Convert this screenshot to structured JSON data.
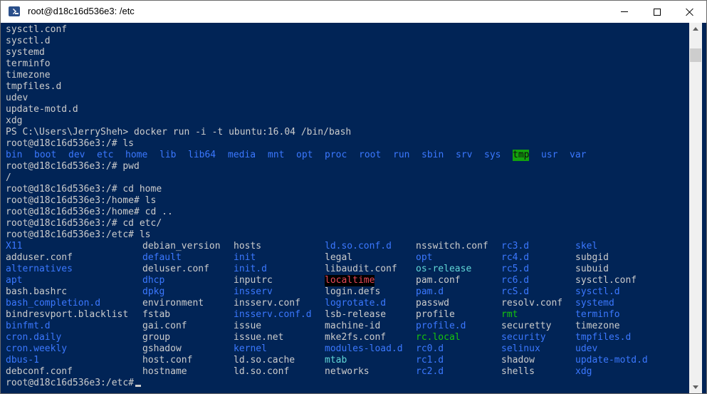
{
  "window": {
    "title": "root@d18c16d536e3: /etc"
  },
  "colors": {
    "background": "#012456",
    "text": "#cccccc",
    "directory": "#3b78ff",
    "symlink": "#61d6d6",
    "executable": "#16c60c",
    "broken_link": "#e74856",
    "sticky_dir_bg": "#13a10e"
  },
  "console": {
    "lines": [
      [
        {
          "t": "sysctl.conf"
        }
      ],
      [
        {
          "t": "sysctl.d"
        }
      ],
      [
        {
          "t": "systemd"
        }
      ],
      [
        {
          "t": "terminfo"
        }
      ],
      [
        {
          "t": "timezone"
        }
      ],
      [
        {
          "t": "tmpfiles.d"
        }
      ],
      [
        {
          "t": "udev"
        }
      ],
      [
        {
          "t": "update-motd.d"
        }
      ],
      [
        {
          "t": "xdg"
        }
      ],
      [
        {
          "t": "PS C:\\Users\\JerrySheh> docker run -i -t ubuntu:16.04 /bin/bash"
        }
      ],
      [
        {
          "t": "root@d18c16d536e3:/# ls"
        }
      ],
      [
        {
          "t": "bin",
          "c": 0,
          "k": "dir"
        },
        {
          "t": "boot",
          "c": 5,
          "k": "dir"
        },
        {
          "t": "dev",
          "c": 11,
          "k": "dir"
        },
        {
          "t": "etc",
          "c": 16,
          "k": "dir"
        },
        {
          "t": "home",
          "c": 21,
          "k": "dir"
        },
        {
          "t": "lib",
          "c": 27,
          "k": "dir"
        },
        {
          "t": "lib64",
          "c": 32,
          "k": "dir"
        },
        {
          "t": "media",
          "c": 39,
          "k": "dir"
        },
        {
          "t": "mnt",
          "c": 46,
          "k": "dir"
        },
        {
          "t": "opt",
          "c": 51,
          "k": "dir"
        },
        {
          "t": "proc",
          "c": 56,
          "k": "dir"
        },
        {
          "t": "root",
          "c": 62,
          "k": "dir"
        },
        {
          "t": "run",
          "c": 68,
          "k": "dir"
        },
        {
          "t": "sbin",
          "c": 73,
          "k": "dir"
        },
        {
          "t": "srv",
          "c": 79,
          "k": "dir"
        },
        {
          "t": "sys",
          "c": 84,
          "k": "dir"
        },
        {
          "t": "tmp",
          "c": 89,
          "k": "tmp"
        },
        {
          "t": "usr",
          "c": 94,
          "k": "dir"
        },
        {
          "t": "var",
          "c": 99,
          "k": "dir"
        }
      ],
      [
        {
          "t": "root@d18c16d536e3:/# pwd"
        }
      ],
      [
        {
          "t": "/"
        }
      ],
      [
        {
          "t": "root@d18c16d536e3:/# cd home"
        }
      ],
      [
        {
          "t": "root@d18c16d536e3:/home# ls"
        }
      ],
      [
        {
          "t": "root@d18c16d536e3:/home# cd .."
        }
      ],
      [
        {
          "t": "root@d18c16d536e3:/# cd etc/"
        }
      ],
      [
        {
          "t": "root@d18c16d536e3:/etc# ls"
        }
      ],
      [
        {
          "t": "X11",
          "c": 0,
          "k": "dir"
        },
        {
          "t": "debian_version",
          "c": 24
        },
        {
          "t": "hosts",
          "c": 40
        },
        {
          "t": "ld.so.conf.d",
          "c": 56,
          "k": "dir"
        },
        {
          "t": "nsswitch.conf",
          "c": 72
        },
        {
          "t": "rc3.d",
          "c": 87,
          "k": "dir"
        },
        {
          "t": "skel",
          "c": 100,
          "k": "dir"
        }
      ],
      [
        {
          "t": "adduser.conf",
          "c": 0
        },
        {
          "t": "default",
          "c": 24,
          "k": "dir"
        },
        {
          "t": "init",
          "c": 40,
          "k": "dir"
        },
        {
          "t": "legal",
          "c": 56
        },
        {
          "t": "opt",
          "c": 72,
          "k": "dir"
        },
        {
          "t": "rc4.d",
          "c": 87,
          "k": "dir"
        },
        {
          "t": "subgid",
          "c": 100
        }
      ],
      [
        {
          "t": "alternatives",
          "c": 0,
          "k": "dir"
        },
        {
          "t": "deluser.conf",
          "c": 24
        },
        {
          "t": "init.d",
          "c": 40,
          "k": "dir"
        },
        {
          "t": "libaudit.conf",
          "c": 56
        },
        {
          "t": "os-release",
          "c": 72,
          "k": "lnk"
        },
        {
          "t": "rc5.d",
          "c": 87,
          "k": "dir"
        },
        {
          "t": "subuid",
          "c": 100
        }
      ],
      [
        {
          "t": "apt",
          "c": 0,
          "k": "dir"
        },
        {
          "t": "dhcp",
          "c": 24,
          "k": "dir"
        },
        {
          "t": "inputrc",
          "c": 40
        },
        {
          "t": "localtime",
          "c": 56,
          "k": "brk"
        },
        {
          "t": "pam.conf",
          "c": 72
        },
        {
          "t": "rc6.d",
          "c": 87,
          "k": "dir"
        },
        {
          "t": "sysctl.conf",
          "c": 100
        }
      ],
      [
        {
          "t": "bash.bashrc",
          "c": 0
        },
        {
          "t": "dpkg",
          "c": 24,
          "k": "dir"
        },
        {
          "t": "insserv",
          "c": 40,
          "k": "dir"
        },
        {
          "t": "login.defs",
          "c": 56
        },
        {
          "t": "pam.d",
          "c": 72,
          "k": "dir"
        },
        {
          "t": "rcS.d",
          "c": 87,
          "k": "dir"
        },
        {
          "t": "sysctl.d",
          "c": 100,
          "k": "dir"
        }
      ],
      [
        {
          "t": "bash_completion.d",
          "c": 0,
          "k": "dir"
        },
        {
          "t": "environment",
          "c": 24
        },
        {
          "t": "insserv.conf",
          "c": 40
        },
        {
          "t": "logrotate.d",
          "c": 56,
          "k": "dir"
        },
        {
          "t": "passwd",
          "c": 72
        },
        {
          "t": "resolv.conf",
          "c": 87
        },
        {
          "t": "systemd",
          "c": 100,
          "k": "dir"
        }
      ],
      [
        {
          "t": "bindresvport.blacklist",
          "c": 0
        },
        {
          "t": "fstab",
          "c": 24
        },
        {
          "t": "insserv.conf.d",
          "c": 40,
          "k": "dir"
        },
        {
          "t": "lsb-release",
          "c": 56
        },
        {
          "t": "profile",
          "c": 72
        },
        {
          "t": "rmt",
          "c": 87,
          "k": "exe"
        },
        {
          "t": "terminfo",
          "c": 100,
          "k": "dir"
        }
      ],
      [
        {
          "t": "binfmt.d",
          "c": 0,
          "k": "dir"
        },
        {
          "t": "gai.conf",
          "c": 24
        },
        {
          "t": "issue",
          "c": 40
        },
        {
          "t": "machine-id",
          "c": 56
        },
        {
          "t": "profile.d",
          "c": 72,
          "k": "dir"
        },
        {
          "t": "securetty",
          "c": 87
        },
        {
          "t": "timezone",
          "c": 100
        }
      ],
      [
        {
          "t": "cron.daily",
          "c": 0,
          "k": "dir"
        },
        {
          "t": "group",
          "c": 24
        },
        {
          "t": "issue.net",
          "c": 40
        },
        {
          "t": "mke2fs.conf",
          "c": 56
        },
        {
          "t": "rc.local",
          "c": 72,
          "k": "exe"
        },
        {
          "t": "security",
          "c": 87,
          "k": "dir"
        },
        {
          "t": "tmpfiles.d",
          "c": 100,
          "k": "dir"
        }
      ],
      [
        {
          "t": "cron.weekly",
          "c": 0,
          "k": "dir"
        },
        {
          "t": "gshadow",
          "c": 24
        },
        {
          "t": "kernel",
          "c": 40,
          "k": "dir"
        },
        {
          "t": "modules-load.d",
          "c": 56,
          "k": "dir"
        },
        {
          "t": "rc0.d",
          "c": 72,
          "k": "dir"
        },
        {
          "t": "selinux",
          "c": 87,
          "k": "dir"
        },
        {
          "t": "udev",
          "c": 100,
          "k": "dir"
        }
      ],
      [
        {
          "t": "dbus-1",
          "c": 0,
          "k": "dir"
        },
        {
          "t": "host.conf",
          "c": 24
        },
        {
          "t": "ld.so.cache",
          "c": 40
        },
        {
          "t": "mtab",
          "c": 56,
          "k": "lnk"
        },
        {
          "t": "rc1.d",
          "c": 72,
          "k": "dir"
        },
        {
          "t": "shadow",
          "c": 87
        },
        {
          "t": "update-motd.d",
          "c": 100,
          "k": "dir"
        }
      ],
      [
        {
          "t": "debconf.conf",
          "c": 0
        },
        {
          "t": "hostname",
          "c": 24
        },
        {
          "t": "ld.so.conf",
          "c": 40
        },
        {
          "t": "networks",
          "c": 56
        },
        {
          "t": "rc2.d",
          "c": 72,
          "k": "dir"
        },
        {
          "t": "shells",
          "c": 87
        },
        {
          "t": "xdg",
          "c": 100,
          "k": "dir"
        }
      ]
    ],
    "prompt": "root@d18c16d536e3:/etc#"
  }
}
